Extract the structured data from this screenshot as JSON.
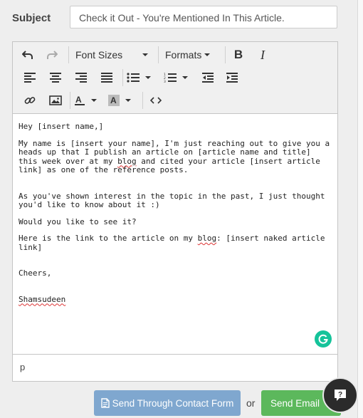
{
  "form": {
    "subject_label": "Subject",
    "subject_value": "Check it Out - You're Mentioned In This Article."
  },
  "toolbar": {
    "font_sizes_label": "Font Sizes",
    "formats_label": "Formats",
    "bold_label": "B",
    "italic_label": "I"
  },
  "email_body": {
    "greeting": "Hey [insert name,]",
    "para1_before": "My name is [insert your name], I'm just reaching out to give you a heads up that I publish an article on [article name and title] this week over at my ",
    "blog_word": "blog",
    "para1_after": " and cited your article [insert article link] as one of the reference posts.",
    "para2": "As you've shown interest in the topic in the past, I just thought you'd like to know about it :)",
    "para3": "Would you like to see it?",
    "para4_before": "Here is the link to the article on my ",
    "para4_blog": "blog",
    "para4_after": ": [insert naked article link]",
    "closing": "Cheers,",
    "signature": "Shamsudeen"
  },
  "statusbar": {
    "path": "p"
  },
  "actions": {
    "send_contact_label": "Send Through Contact Form",
    "or_text": "or",
    "send_email_label": "Send Email"
  },
  "icons": {
    "undo": "undo-icon",
    "redo": "redo-icon",
    "align_left": "align-left-icon",
    "align_center": "align-center-icon",
    "align_right": "align-right-icon",
    "justify": "justify-icon",
    "bullet_list": "bullet-list-icon",
    "numbered_list": "numbered-list-icon",
    "outdent": "outdent-icon",
    "indent": "indent-icon",
    "link": "link-icon",
    "image": "image-icon",
    "text_color": "text-color-icon",
    "bg_color": "background-color-icon",
    "code": "source-code-icon",
    "grammarly": "grammarly-icon",
    "chat": "chat-help-icon",
    "document": "document-icon"
  },
  "colors": {
    "contact_button": "#7fa7cf",
    "email_button": "#5cb85c",
    "grammarly": "#15c39a",
    "chat_bubble": "#2b2b2b"
  }
}
